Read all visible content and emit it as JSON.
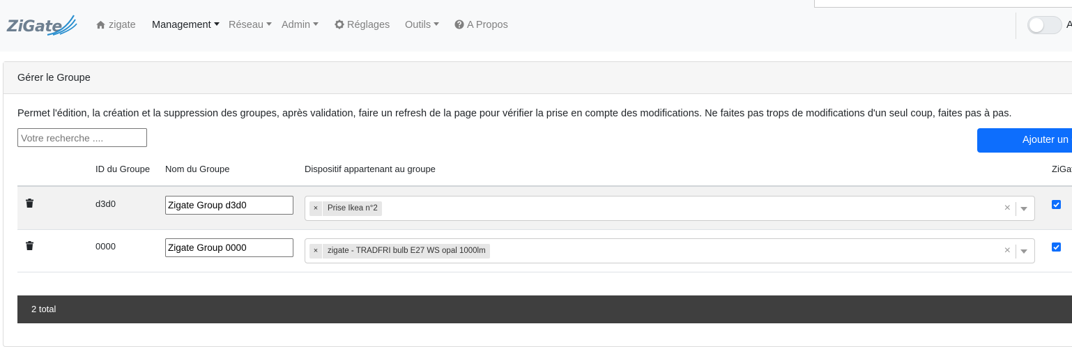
{
  "brand": {
    "name": "ZiGate"
  },
  "nav": {
    "items": [
      {
        "label": "zigate",
        "icon": "home-icon"
      },
      {
        "label": "Management",
        "dropdown": true,
        "active": true
      },
      {
        "label": "Réseau",
        "dropdown": true
      },
      {
        "label": "Admin",
        "dropdown": true
      },
      {
        "label": "Réglages",
        "icon": "gear-icon"
      },
      {
        "label": "Outils",
        "dropdown": true
      },
      {
        "label": "A Propos",
        "icon": "question-circle-icon"
      }
    ],
    "toggle_label": "A"
  },
  "card": {
    "title": "Gérer le Groupe",
    "description": "Permet l'édition, la création et la suppression des groupes, après validation, faire un refresh de la page pour vérifier la prise en compte des modifications. Ne faites pas trops de modifications d'un seul coup, faites pas à pas.",
    "search_placeholder": "Votre recherche ....",
    "add_button": "Ajouter un G"
  },
  "table": {
    "columns": [
      "ID du Groupe",
      "Nom du Groupe",
      "Dispositif appartenant au groupe",
      "ZiGate"
    ],
    "rows": [
      {
        "id": "d3d0",
        "name": "Zigate Group d3d0",
        "device": "Prise Ikea n°2",
        "checked": true
      },
      {
        "id": "0000",
        "name": "Zigate Group 0000",
        "device": "zigate - TRADFRI bulb E27 WS opal 1000lm",
        "checked": true
      }
    ],
    "chip_remove": "×",
    "clear_symbol": "×",
    "total": "2 total"
  },
  "colors": {
    "primary": "#0d6efd",
    "footer": "#3f3f3f",
    "navbar": "#f8f9fa"
  }
}
